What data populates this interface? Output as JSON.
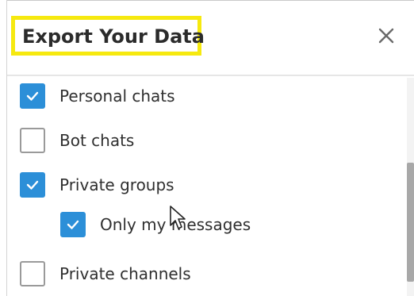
{
  "dialog": {
    "title": "Export Your Data",
    "close_icon": "close-icon",
    "highlight_color": "#f6e90f",
    "accent_color": "#2c8fd8"
  },
  "options": [
    {
      "label": "Personal chats",
      "checked": true
    },
    {
      "label": "Bot chats",
      "checked": false
    },
    {
      "label": "Private groups",
      "checked": true
    },
    {
      "label": "Only my messages",
      "checked": true
    },
    {
      "label": "Private channels",
      "checked": false
    }
  ]
}
